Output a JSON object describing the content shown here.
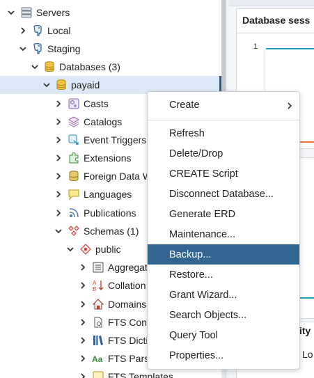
{
  "tree": {
    "items": [
      {
        "label": "Servers",
        "icon": "servers-icon"
      },
      {
        "label": "Local",
        "icon": "postgres-elephant-icon"
      },
      {
        "label": "Staging",
        "icon": "postgres-elephant-icon"
      },
      {
        "label": "Databases (3)",
        "icon": "databases-icon"
      },
      {
        "label": "payaid",
        "icon": "database-icon"
      },
      {
        "label": "Casts",
        "icon": "casts-icon"
      },
      {
        "label": "Catalogs",
        "icon": "catalogs-icon"
      },
      {
        "label": "Event Triggers",
        "icon": "event-triggers-icon"
      },
      {
        "label": "Extensions",
        "icon": "extensions-icon"
      },
      {
        "label": "Foreign Data W",
        "icon": "foreign-data-wrapper-icon"
      },
      {
        "label": "Languages",
        "icon": "languages-icon"
      },
      {
        "label": "Publications",
        "icon": "publications-icon"
      },
      {
        "label": "Schemas (1)",
        "icon": "schemas-icon"
      },
      {
        "label": "public",
        "icon": "schema-icon"
      },
      {
        "label": "Aggregat",
        "icon": "aggregates-icon"
      },
      {
        "label": "Collation",
        "icon": "collations-icon"
      },
      {
        "label": "Domains",
        "icon": "domains-icon"
      },
      {
        "label": "FTS Conf",
        "icon": "fts-config-icon"
      },
      {
        "label": "FTS Dicti",
        "icon": "fts-dictionary-icon"
      },
      {
        "label": "FTS Pars",
        "icon": "fts-parser-icon"
      },
      {
        "label": "FTS Templates",
        "icon": "fts-templates-icon"
      }
    ]
  },
  "right_pane": {
    "panel_title": "Database sess",
    "axis_value": "1",
    "panel3_title": "ity",
    "panel4_text": "Lo"
  },
  "context_menu": {
    "items": [
      {
        "label": "Create",
        "has_submenu": true
      },
      {
        "label": "Refresh"
      },
      {
        "label": "Delete/Drop"
      },
      {
        "label": "CREATE Script"
      },
      {
        "label": "Disconnect Database..."
      },
      {
        "label": "Generate ERD"
      },
      {
        "label": "Maintenance..."
      },
      {
        "label": "Backup...",
        "highlighted": true
      },
      {
        "label": "Restore..."
      },
      {
        "label": "Grant Wizard..."
      },
      {
        "label": "Search Objects..."
      },
      {
        "label": "Query Tool"
      },
      {
        "label": "Properties..."
      }
    ]
  },
  "colors": {
    "selection_bg": "#dde9f6",
    "menu_highlight": "#326690",
    "chart_teal": "#17a2b8",
    "chart_orange": "#e8743b"
  }
}
